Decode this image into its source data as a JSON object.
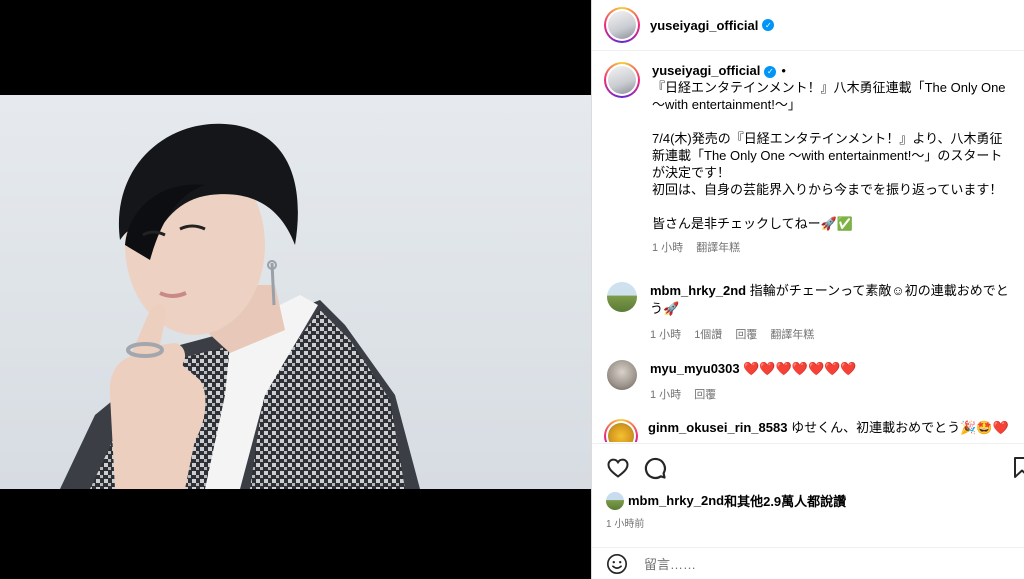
{
  "post": {
    "username": "yuseiyagi_official",
    "verified": true
  },
  "caption": {
    "username": "yuseiyagi_official",
    "dot": "•",
    "lines": [
      "『日経エンタテインメント！』八木勇征連載「The Only One ～with entertainment!～」",
      "",
      "7/4(木)発売の『日経エンタテインメント！』より、八木勇征新連載「The Only One ～with entertainment!～」のスタートが決定です！",
      "初回は、自身の芸能界入りから今までを振り返っています！",
      "",
      "皆さん是非チェックしてねー🚀✅"
    ],
    "time": "1 小時",
    "translate": "翻譯年糕"
  },
  "comments": [
    {
      "username": "mbm_hrky_2nd",
      "text": "指輪がチェーンって素敵☺初の連載おめでとう🚀",
      "time": "1 小時",
      "likes": "1個讚",
      "reply": "回覆",
      "translate": "翻譯年糕"
    },
    {
      "username": "myu_myu0303",
      "text": "❤️❤️❤️❤️❤️❤️❤️",
      "time": "1 小時",
      "reply": "回覆"
    },
    {
      "username": "ginm_okusei_rin_8583",
      "text": "ゆせくん、初連載おめでとう🎉🤩❤️"
    }
  ],
  "likes_line": {
    "name": "mbm_hrky_2nd",
    "rest": "和其他2.9萬人都說讚"
  },
  "time_ago": "1 小時前",
  "comment_input": {
    "placeholder": "留言……"
  },
  "icons": {
    "like": "heart-icon",
    "comment": "comment-bubble-icon",
    "save": "bookmark-icon",
    "emoji": "emoji-icon",
    "verified": "verified-badge-icon"
  },
  "colors": {
    "verified_blue": "#0095f6",
    "secondary_text": "#737373",
    "border": "#efefef"
  }
}
